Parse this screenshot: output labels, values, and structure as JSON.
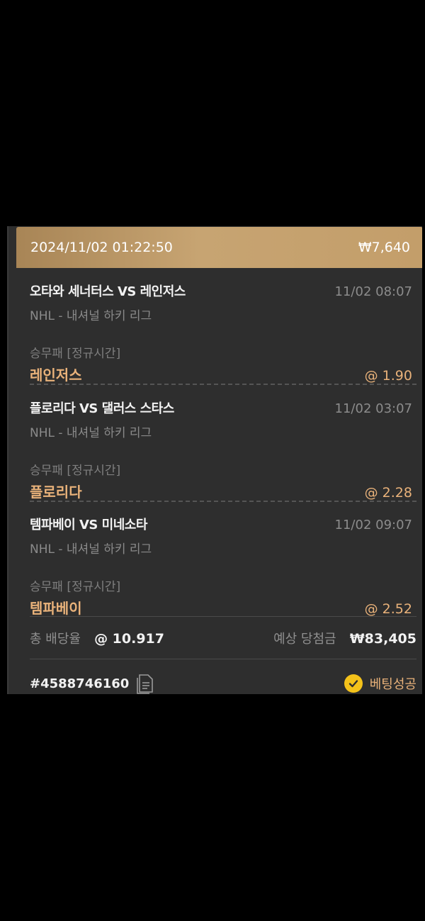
{
  "slip": {
    "datetime": "2024/11/02 01:22:50",
    "stake": "₩7,640",
    "bets": [
      {
        "match": "오타와 세너터스 VS 레인저스",
        "time": "11/02 08:07",
        "league": "NHL - 내셔널 하키 리그",
        "market": "승무패 [정규시간]",
        "pick": "레인저스",
        "odds": "@ 1.90"
      },
      {
        "match": "플로리다 VS 댈러스 스타스",
        "time": "11/02 03:07",
        "league": "NHL - 내셔널 하키 리그",
        "market": "승무패 [정규시간]",
        "pick": "플로리다",
        "odds": "@ 2.28"
      },
      {
        "match": "템파베이 VS 미네소타",
        "time": "11/02 09:07",
        "league": "NHL - 내셔널 하키 리그",
        "market": "승무패 [정규시간]",
        "pick": "템파베이",
        "odds": "@ 2.52"
      }
    ],
    "summary": {
      "total_odds_label": "총 배당율",
      "total_odds": "@ 10.917",
      "expected_win_label": "예상 당첨금",
      "expected_win": "₩83,405"
    },
    "ticket_id": "#4588746160",
    "status": "베팅성공"
  },
  "icons": {
    "copy": "document-copy-icon",
    "check": "check-circle-icon"
  },
  "colors": {
    "header_gold": "#c39e6a",
    "pick_orange": "#e9b27a",
    "status_yellow": "#f4c21a"
  }
}
